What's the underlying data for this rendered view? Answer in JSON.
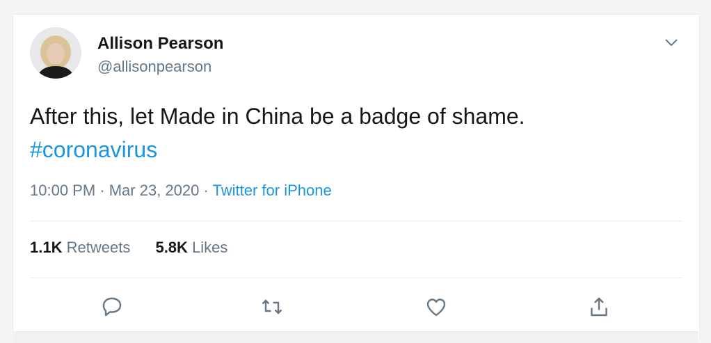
{
  "author": {
    "display_name": "Allison Pearson",
    "handle": "@allisonpearson"
  },
  "tweet": {
    "text": "After this, let Made in China be a badge of shame.",
    "hashtag": "#coronavirus"
  },
  "meta": {
    "time": "10:00 PM",
    "separator1": " · ",
    "date": "Mar 23, 2020",
    "separator2": " · ",
    "source": "Twitter for iPhone"
  },
  "stats": {
    "retweets_count": "1.1K",
    "retweets_label": "Retweets",
    "likes_count": "5.8K",
    "likes_label": "Likes"
  },
  "actions": [
    "reply-icon",
    "retweet-icon",
    "like-icon",
    "share-icon"
  ],
  "colors": {
    "link": "#1b95e0",
    "secondary_text": "#657786",
    "primary_text": "#14171a",
    "icon": "#657786"
  }
}
